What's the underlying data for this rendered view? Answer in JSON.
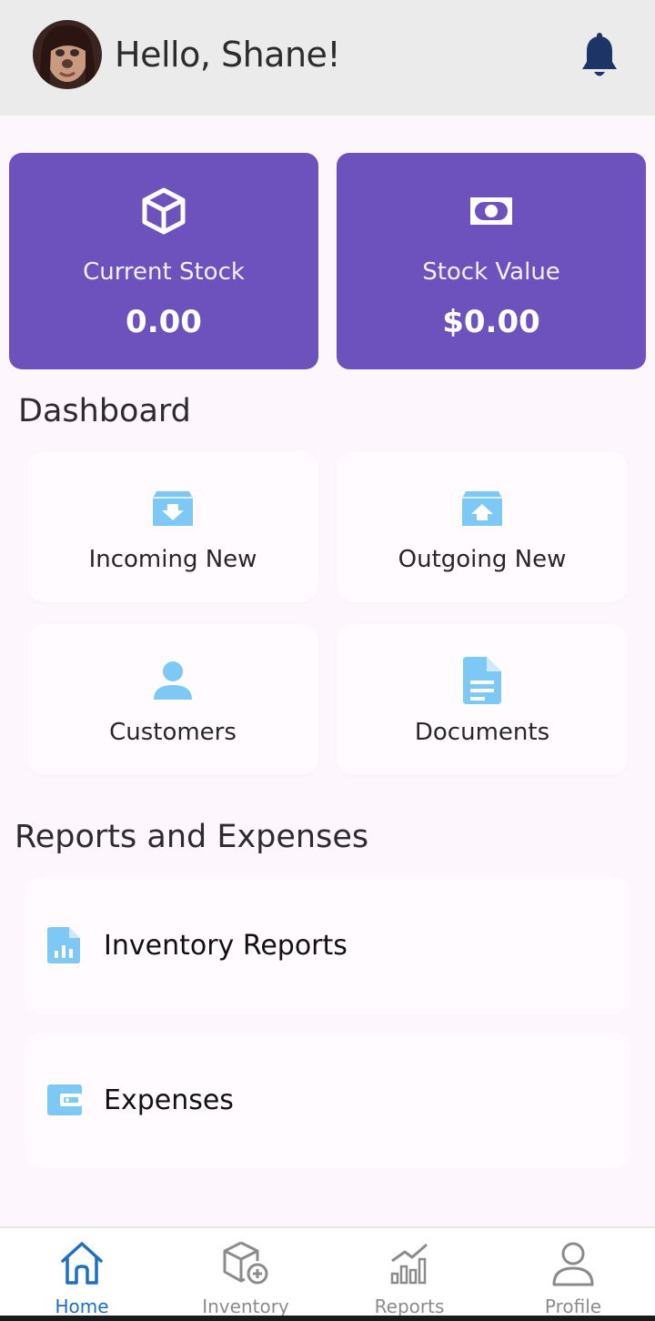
{
  "header": {
    "greeting": "Hello, Shane!",
    "avatar_icon": "user-photo-avatar",
    "notification_icon": "bell-icon"
  },
  "stats": [
    {
      "label": "Current Stock",
      "value": "0.00",
      "icon": "box-icon"
    },
    {
      "label": "Stock Value",
      "value": "$0.00",
      "icon": "cash-icon"
    }
  ],
  "dashboard": {
    "title": "Dashboard",
    "items": [
      {
        "label": "Incoming New",
        "icon": "archive-down-icon"
      },
      {
        "label": "Outgoing New",
        "icon": "archive-up-icon"
      },
      {
        "label": "Customers",
        "icon": "person-icon"
      },
      {
        "label": "Documents",
        "icon": "document-icon"
      }
    ]
  },
  "reports": {
    "title": "Reports and Expenses",
    "items": [
      {
        "label": "Inventory Reports",
        "icon": "report-chart-icon"
      },
      {
        "label": "Expenses",
        "icon": "wallet-icon"
      }
    ]
  },
  "nav": {
    "items": [
      {
        "label": "Home",
        "icon": "home-icon",
        "active": true
      },
      {
        "label": "Inventory",
        "icon": "inventory-box-icon",
        "active": false
      },
      {
        "label": "Reports",
        "icon": "bar-chart-icon",
        "active": false
      },
      {
        "label": "Profile",
        "icon": "profile-icon",
        "active": false
      }
    ]
  },
  "colors": {
    "accent": "#6d52bd",
    "icon_light_blue": "#7ec8f5",
    "nav_active": "#1d6fc4",
    "bell": "#1c3566"
  }
}
